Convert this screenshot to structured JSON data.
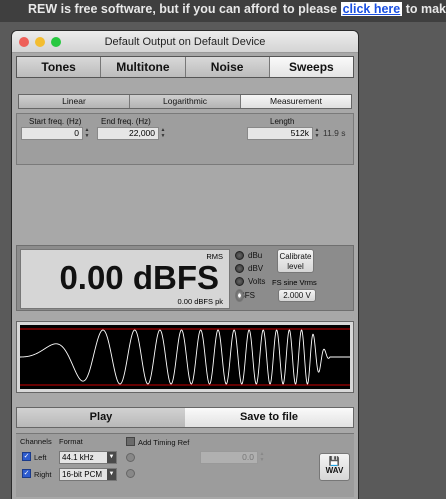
{
  "banner": {
    "text_before": "REW is free software, but if you can afford to please ",
    "link": "click here",
    "text_after": " to make a donation"
  },
  "window": {
    "title": "Default Output on Default Device"
  },
  "tabs": [
    {
      "label": "Tones"
    },
    {
      "label": "Multitone"
    },
    {
      "label": "Noise"
    },
    {
      "label": "Sweeps"
    }
  ],
  "subtabs": [
    {
      "label": "Linear"
    },
    {
      "label": "Logarithmic"
    },
    {
      "label": "Measurement"
    }
  ],
  "params": {
    "start_label": "Start freq. (Hz)",
    "start_value": "0",
    "end_label": "End freq. (Hz)",
    "end_value": "22,000",
    "length_label": "Length",
    "length_value": "512k",
    "length_seconds": "11.9 s"
  },
  "meter": {
    "rms_label": "RMS",
    "value": "0.00 dBFS",
    "peak": "0.00 dBFS pk"
  },
  "units": [
    {
      "label": "dBu"
    },
    {
      "label": "dBV"
    },
    {
      "label": "Volts"
    },
    {
      "label": "dBFS"
    }
  ],
  "calibrate_label": "Calibrate level",
  "fs_sine_label": "FS sine Vrms",
  "fs_sine_value": "2.000 V",
  "actions": {
    "play": "Play",
    "save": "Save to file"
  },
  "bottom": {
    "channels_label": "Channels",
    "format_label": "Format",
    "left_label": "Left",
    "right_label": "Right",
    "sample_rate": "44.1 kHz",
    "bit_depth": "16-bit PCM",
    "timing_ref_label": "Add Timing Ref",
    "timing_value": "0.0",
    "wav_label": "WAV"
  }
}
